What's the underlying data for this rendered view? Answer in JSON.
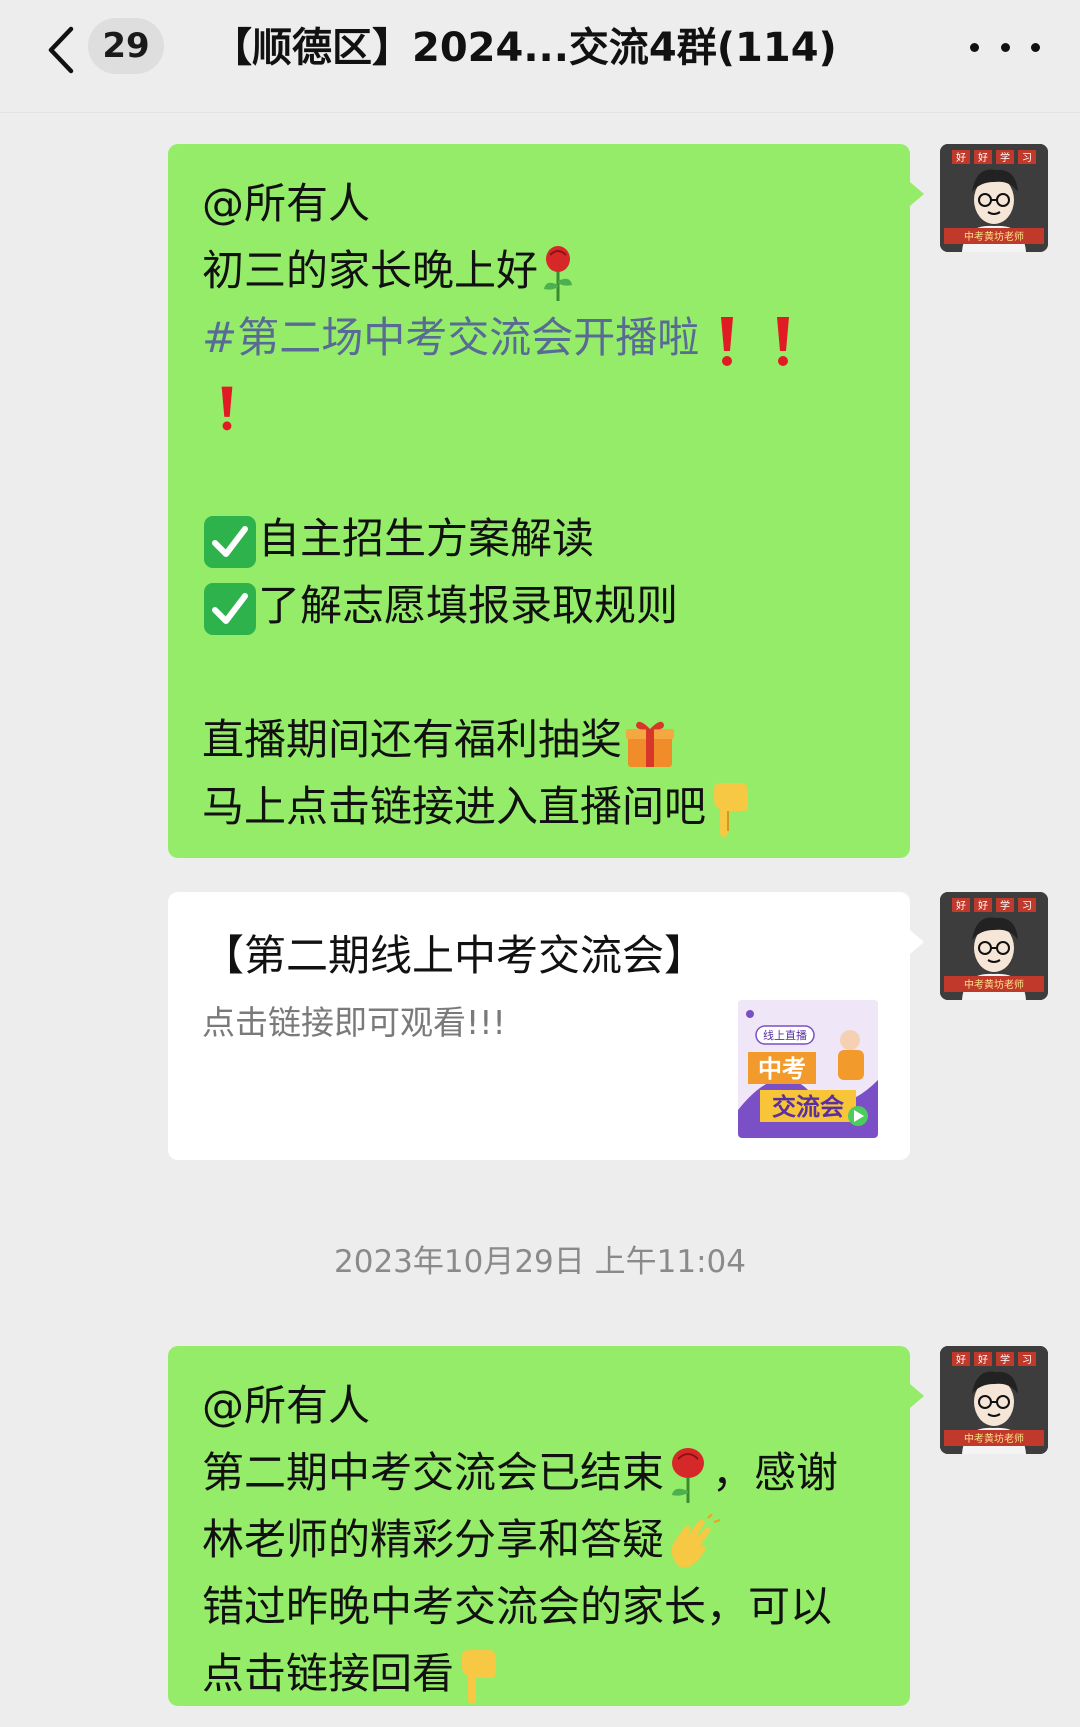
{
  "header": {
    "unread_count": "29",
    "title": "【顺德区】2024...交流4群(114)"
  },
  "messages": [
    {
      "lines": {
        "l1": "@所有人",
        "l2": "初三的家长晚上好",
        "l3": "#第二场中考交流会开播啦",
        "l5": "自主招生方案解读",
        "l6": "了解志愿填报录取规则",
        "l8": "直播期间还有福利抽奖",
        "l9": "马上点击链接进入直播间吧"
      }
    },
    {
      "link_title": "【第二期线上中考交流会】",
      "link_desc": "点击链接即可观看!!!",
      "thumb": {
        "tag": "线上直播",
        "line1": "中考",
        "line2": "交流会"
      }
    },
    {
      "lines": {
        "l1": "@所有人",
        "l2a": "第二期中考交流会已结束",
        "l2b": "，感谢",
        "l3": "林老师的精彩分享和答疑",
        "l4": "错过昨晚中考交流会的家长，可以",
        "l5": "点击链接回看"
      }
    }
  ],
  "timestamp": "2023年10月29日 上午11:04",
  "avatar": {
    "top_chars": [
      "好",
      "好",
      "学",
      "习"
    ],
    "caption": "中考黄坊老师"
  },
  "colors": {
    "bubble_green": "#95ec69",
    "hashtag_blue": "#576b95",
    "background": "#ededed"
  },
  "icons": [
    "chevron-left-icon",
    "more-icon",
    "rose-icon",
    "exclamation-icon",
    "check-box-icon",
    "gift-icon",
    "pointing-down-icon",
    "clap-icon"
  ]
}
